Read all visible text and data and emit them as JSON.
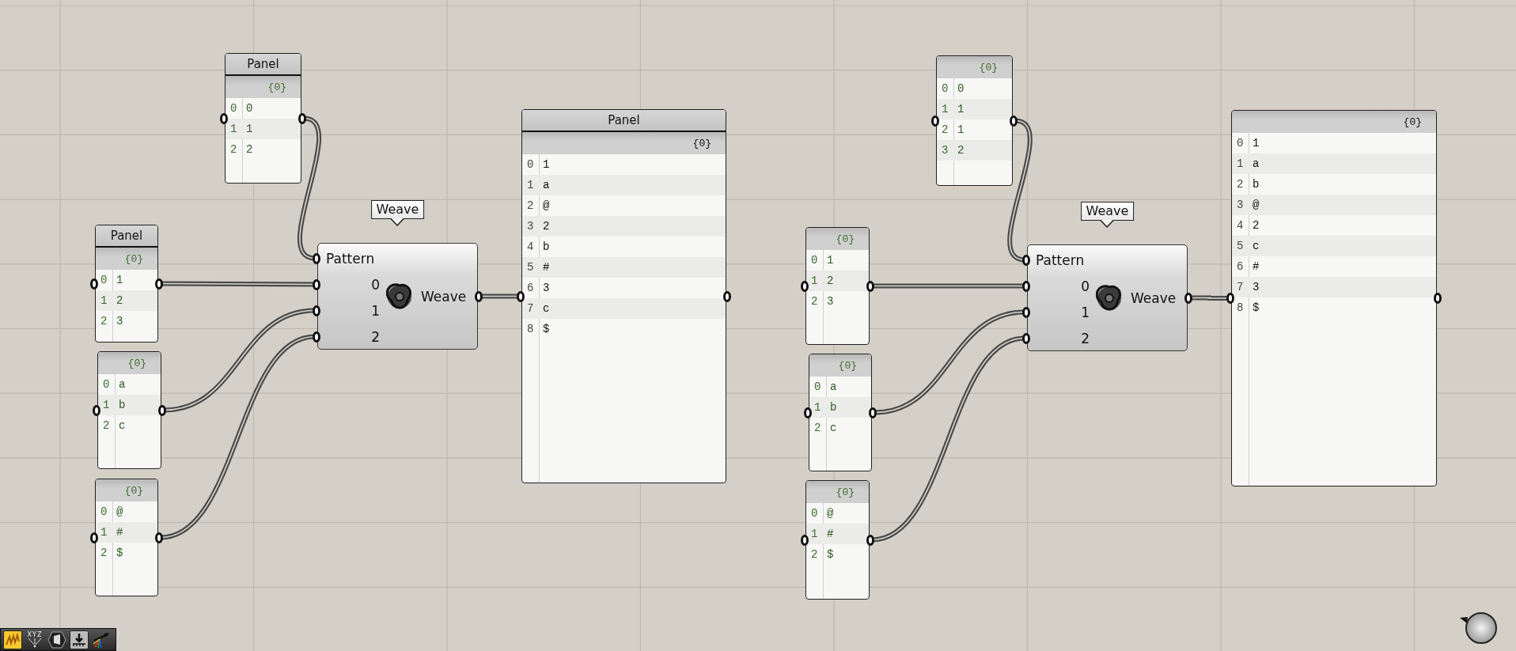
{
  "groups": [
    {
      "pattern_panel": {
        "title": "Panel",
        "path": "{0}",
        "rows": [
          {
            "index": "0",
            "value": "0"
          },
          {
            "index": "1",
            "value": "1"
          },
          {
            "index": "2",
            "value": "2"
          }
        ]
      },
      "list_panels": [
        {
          "title": "Panel",
          "path": "{0}",
          "rows": [
            {
              "index": "0",
              "value": "1"
            },
            {
              "index": "1",
              "value": "2"
            },
            {
              "index": "2",
              "value": "3"
            }
          ]
        },
        {
          "path": "{0}",
          "rows": [
            {
              "index": "0",
              "value": "a"
            },
            {
              "index": "1",
              "value": "b"
            },
            {
              "index": "2",
              "value": "c"
            }
          ]
        },
        {
          "path": "{0}",
          "rows": [
            {
              "index": "0",
              "value": "@"
            },
            {
              "index": "1",
              "value": "#"
            },
            {
              "index": "2",
              "value": "$"
            }
          ]
        }
      ],
      "component": {
        "tooltip": "Weave",
        "inputs": [
          "Pattern",
          "0",
          "1",
          "2"
        ],
        "output": "Weave"
      },
      "result_panel": {
        "title": "Panel",
        "path": "{0}",
        "rows": [
          {
            "index": "0",
            "value": "1"
          },
          {
            "index": "1",
            "value": "a"
          },
          {
            "index": "2",
            "value": "@"
          },
          {
            "index": "3",
            "value": "2"
          },
          {
            "index": "4",
            "value": "b"
          },
          {
            "index": "5",
            "value": "#"
          },
          {
            "index": "6",
            "value": "3"
          },
          {
            "index": "7",
            "value": "c"
          },
          {
            "index": "8",
            "value": "$"
          }
        ]
      }
    },
    {
      "pattern_panel": {
        "path": "{0}",
        "rows": [
          {
            "index": "0",
            "value": "0"
          },
          {
            "index": "1",
            "value": "1"
          },
          {
            "index": "2",
            "value": "1"
          },
          {
            "index": "3",
            "value": "2"
          }
        ]
      },
      "list_panels": [
        {
          "path": "{0}",
          "rows": [
            {
              "index": "0",
              "value": "1"
            },
            {
              "index": "1",
              "value": "2"
            },
            {
              "index": "2",
              "value": "3"
            }
          ]
        },
        {
          "path": "{0}",
          "rows": [
            {
              "index": "0",
              "value": "a"
            },
            {
              "index": "1",
              "value": "b"
            },
            {
              "index": "2",
              "value": "c"
            }
          ]
        },
        {
          "path": "{0}",
          "rows": [
            {
              "index": "0",
              "value": "@"
            },
            {
              "index": "1",
              "value": "#"
            },
            {
              "index": "2",
              "value": "$"
            }
          ]
        }
      ],
      "component": {
        "tooltip": "Weave",
        "inputs": [
          "Pattern",
          "0",
          "1",
          "2"
        ],
        "output": "Weave"
      },
      "result_panel": {
        "path": "{0}",
        "rows": [
          {
            "index": "0",
            "value": "1"
          },
          {
            "index": "1",
            "value": "a"
          },
          {
            "index": "2",
            "value": "b"
          },
          {
            "index": "3",
            "value": "@"
          },
          {
            "index": "4",
            "value": "2"
          },
          {
            "index": "5",
            "value": "c"
          },
          {
            "index": "6",
            "value": "#"
          },
          {
            "index": "7",
            "value": "3"
          },
          {
            "index": "8",
            "value": "$"
          }
        ]
      }
    }
  ],
  "toolbar": [
    {
      "kind": "sketch"
    },
    {
      "kind": "axes",
      "label": "XYZ"
    },
    {
      "kind": "box"
    },
    {
      "kind": "bake"
    },
    {
      "kind": "gradient"
    }
  ]
}
